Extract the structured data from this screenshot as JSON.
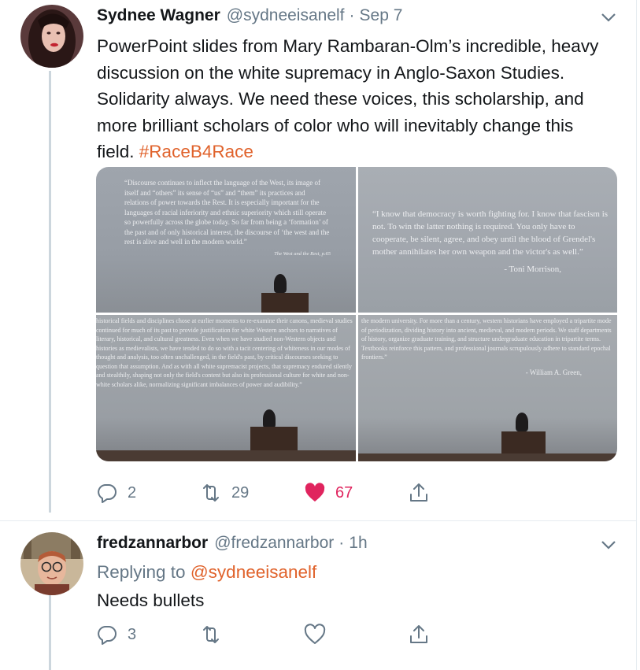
{
  "tweets": [
    {
      "name": "Sydnee Wagner",
      "handle": "@sydneeisanelf",
      "separator": "·",
      "date": "Sep 7",
      "text": "PowerPoint slides from Mary Rambaran-Olm’s incredible, heavy discussion on the white supremacy in Anglo-Saxon Studies. Solidarity always. We need these voices, this scholarship, and more brilliant scholars of color who will inevitably change this field.",
      "hashtag": "#RaceB4Race",
      "media": [
        {
          "text": "“Discourse continues to inflect the language of the West, its image of itself and “others” its sense of “us” and “them” its practices and relations of power towards the Rest. It is especially important for the languages of racial inferiority and ethnic superiority which still operate so powerfully across the globe today. So far from being a ‘formation’ of the past and of only historical interest, the discourse of ‘the west and the rest is alive and well in the modern world.”",
          "cite": "The West and the Rest, p.65"
        },
        {
          "text": "“I know that democracy is worth fighting for. I know that fascism is not. To win the latter nothing is required. You only have to cooperate, be silent, agree, and obey until the blood of Grendel's mother annihilates her own weapon and the victor's as well.”",
          "cite": "- Toni Morrison,"
        },
        {
          "text": "historical fields and disciplines chose at earlier moments to re-examine their canons, medieval studies continued for much of its past to provide justification for white Western anchors to narratives of literary, historical, and cultural greatness. Even when we have studied non-Western objects and histories as medievalists, we have tended to do so with a tacit centering of whiteness in our modes of thought and analysis, too often unchallenged, in the field's past, by critical discourses seeking to question that assumption. And as with all white supremacist projects, that supremacy endured silently and stealthily, shaping not only the field's content but also its professional culture for white and non-white scholars alike, normalizing significant imbalances of power and audibility.”",
          "cite": ""
        },
        {
          "text": "the modern university. For more than a century, western historians have employed a tripartite mode of periodization, dividing history into ancient, medieval, and modern periods. We staff departments of history, organize graduate training, and structure undergraduate education in tripartite terms. Textbooks reinforce this pattern, and professional journals scrupulously adhere to standard epochal frontiers.”",
          "cite": "- William A. Green,"
        }
      ],
      "actions": {
        "replies": "2",
        "retweets": "29",
        "likes": "67"
      },
      "liked": true
    },
    {
      "name": "fredzannarbor",
      "handle": "@fredzannarbor",
      "separator": "·",
      "date": "1h",
      "reply_prefix": "Replying to",
      "reply_mention": "@sydneeisanelf",
      "text": "Needs bullets",
      "actions": {
        "replies": "3"
      },
      "liked": false
    }
  ],
  "colors": {
    "accent": "#e0622b",
    "like": "#e0245e",
    "muted": "#657786",
    "text": "#14171a"
  }
}
